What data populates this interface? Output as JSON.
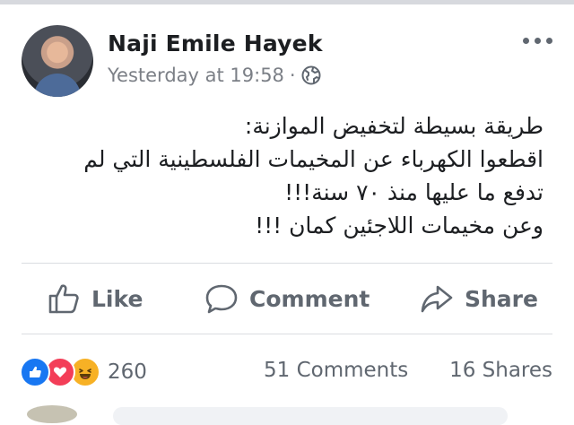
{
  "post": {
    "author": "Naji Emile Hayek",
    "timestamp": "Yesterday at 19:58",
    "separator": "·",
    "privacy_icon": "globe-icon",
    "menu_icon": "more-options-icon",
    "text_lines": [
      "طريقة بسيطة لتخفيض الموازنة:",
      "اقطعوا الكهرباء عن المخيمات الفلسطينية التي لم",
      "تدفع ما عليها منذ ٧٠ سنة!!!",
      "وعن مخيمات اللاجئين كمان !!!"
    ]
  },
  "actions": {
    "like": "Like",
    "comment": "Comment",
    "share": "Share"
  },
  "stats": {
    "reaction_icons": [
      "like-reaction-icon",
      "love-reaction-icon",
      "haha-reaction-icon"
    ],
    "reaction_count": "260",
    "comments": "51 Comments",
    "shares": "16 Shares"
  },
  "colors": {
    "text": "#1c1e21",
    "secondary_text": "#606770",
    "meta_text": "#7b7f86",
    "divider": "#dadde1",
    "like_blue": "#1877f2",
    "love_red": "#f33e58",
    "haha_yellow": "#f7b125"
  }
}
